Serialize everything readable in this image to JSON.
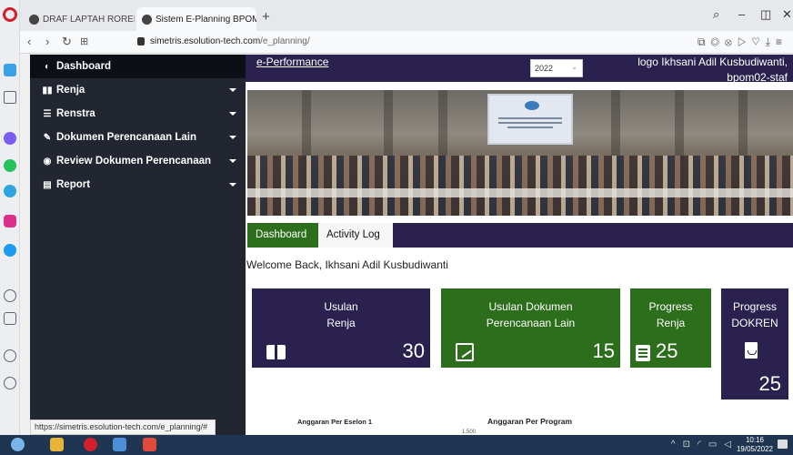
{
  "browser": {
    "tabs": [
      {
        "label": "DRAF LAPTAH RORENKEU"
      },
      {
        "label": "Sistem E-Planning BPOM"
      }
    ],
    "new_tab_symbol": "+",
    "url_host": "simetris.esolution-tech.com",
    "url_path": "/e_planning/",
    "status_url": "https://simetris.esolution-tech.com/e_planning/#",
    "controls": {
      "search": "⌕",
      "minimize": "–",
      "maximize": "◫",
      "close": "✕"
    }
  },
  "sidebar": {
    "items": [
      {
        "label": "Dashboard",
        "icon": "dashboard-icon",
        "active": true
      },
      {
        "label": "Renja",
        "icon": "map-icon",
        "has_caret": true
      },
      {
        "label": "Renstra",
        "icon": "list-icon",
        "has_caret": true
      },
      {
        "label": "Dokumen Perencanaan Lain",
        "icon": "edit-doc-icon",
        "has_caret": true
      },
      {
        "label": "Review Dokumen Perencanaan",
        "icon": "eye-icon",
        "has_caret": true
      },
      {
        "label": "Report",
        "icon": "file-icon",
        "has_caret": true
      }
    ]
  },
  "topnav": {
    "link": "e-Performance",
    "year": "2022",
    "logo_alt": "logo",
    "user_name": "Ikhsani Adil Kusbudiwanti,",
    "user_role": "bpom02-staf"
  },
  "tabs": {
    "dashboard": "Dashboard",
    "activity": "Activity Log"
  },
  "welcome": "Welcome Back, Ikhsani Adil Kusbudiwanti",
  "cards": [
    {
      "title1": "Usulan",
      "title2": "Renja",
      "value": "30",
      "icon": "book-icon"
    },
    {
      "title1": "Usulan Dokumen",
      "title2": "Perencanaan Lain",
      "value": "15",
      "icon": "signature-icon"
    },
    {
      "title1": "Progress",
      "title2": "Renja",
      "value": "25",
      "icon": "document-lines-icon"
    },
    {
      "title1": "Progress",
      "title2": "DOKREN",
      "value": "25",
      "icon": "pdf-icon"
    }
  ],
  "charts": {
    "left_title": "Anggaran Per Eselon 1",
    "right_title": "Anggaran Per Program",
    "right_tick": "1.500"
  },
  "taskbar": {
    "time": "10:16",
    "date": "19/05/2022"
  },
  "colors": {
    "sidebar_bg": "#222631",
    "nav_purple": "#2a214f",
    "accent_green": "#2c6e1b"
  }
}
